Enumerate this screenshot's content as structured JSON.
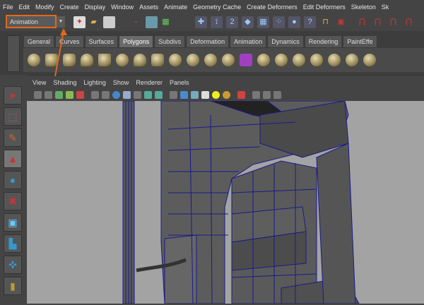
{
  "menubar": {
    "items": [
      "File",
      "Edit",
      "Modify",
      "Create",
      "Display",
      "Window",
      "Assets",
      "Animate",
      "Geometry Cache",
      "Create Deformers",
      "Edit Deformers",
      "Skeleton",
      "Sk"
    ]
  },
  "toolbar": {
    "mode_selector": "Animation",
    "highlight_color": "#e06a1b"
  },
  "shelf": {
    "tabs": [
      "General",
      "Curves",
      "Surfaces",
      "Polygons",
      "Subdivs",
      "Deformation",
      "Animation",
      "Dynamics",
      "Rendering",
      "PaintEffe"
    ],
    "active_tab": "Polygons"
  },
  "panel": {
    "menu": [
      "View",
      "Shading",
      "Lighting",
      "Show",
      "Renderer",
      "Panels"
    ]
  },
  "colors": {
    "viewport_bg": "#a3a3a3",
    "wireframe": "#1a1a8c",
    "mesh": "#565656"
  }
}
